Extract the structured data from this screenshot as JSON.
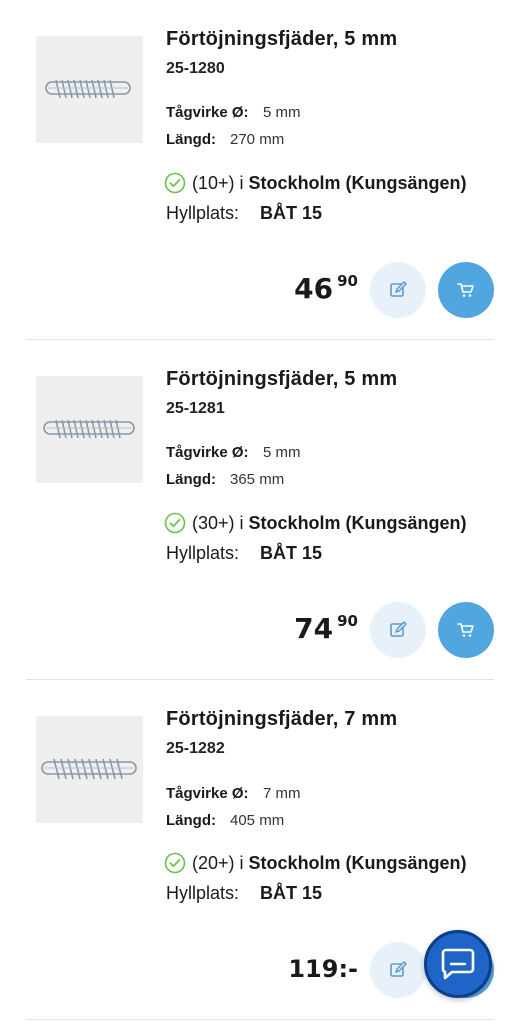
{
  "products": [
    {
      "title": "Förtöjningsfjäder, 5 mm",
      "sku": "25-1280",
      "spec_label_rope": "Tågvirke Ø:",
      "spec_rope": "5 mm",
      "spec_label_length": "Längd:",
      "spec_length": "270 mm",
      "stock_count": "(10+) i",
      "stock_store": "Stockholm (Kungsängen)",
      "shelf_label": "Hyllplats:",
      "shelf_value": "BÅT 15",
      "price_main": "46",
      "price_cents": "90"
    },
    {
      "title": "Förtöjningsfjäder, 5 mm",
      "sku": "25-1281",
      "spec_label_rope": "Tågvirke Ø:",
      "spec_rope": "5 mm",
      "spec_label_length": "Längd:",
      "spec_length": "365 mm",
      "stock_count": "(30+) i",
      "stock_store": "Stockholm (Kungsängen)",
      "shelf_label": "Hyllplats:",
      "shelf_value": "BÅT 15",
      "price_main": "74",
      "price_cents": "90"
    },
    {
      "title": "Förtöjningsfjäder, 7 mm",
      "sku": "25-1282",
      "spec_label_rope": "Tågvirke Ø:",
      "spec_rope": "7 mm",
      "spec_label_length": "Längd:",
      "spec_length": "405 mm",
      "stock_count": "(20+) i",
      "stock_store": "Stockholm (Kungsängen)",
      "shelf_label": "Hyllplats:",
      "shelf_value": "BÅT 15",
      "price_flat": "119:-"
    }
  ],
  "icons": {
    "stock": "check-circle-icon",
    "note": "edit-note-icon",
    "cart": "shopping-cart-icon",
    "chat": "chat-bubble-icon"
  },
  "colors": {
    "check_green": "#6bbf4e",
    "cart_blue": "#52a6df",
    "note_bg": "#e8f1fa",
    "chat_blue": "#1f65c7"
  }
}
